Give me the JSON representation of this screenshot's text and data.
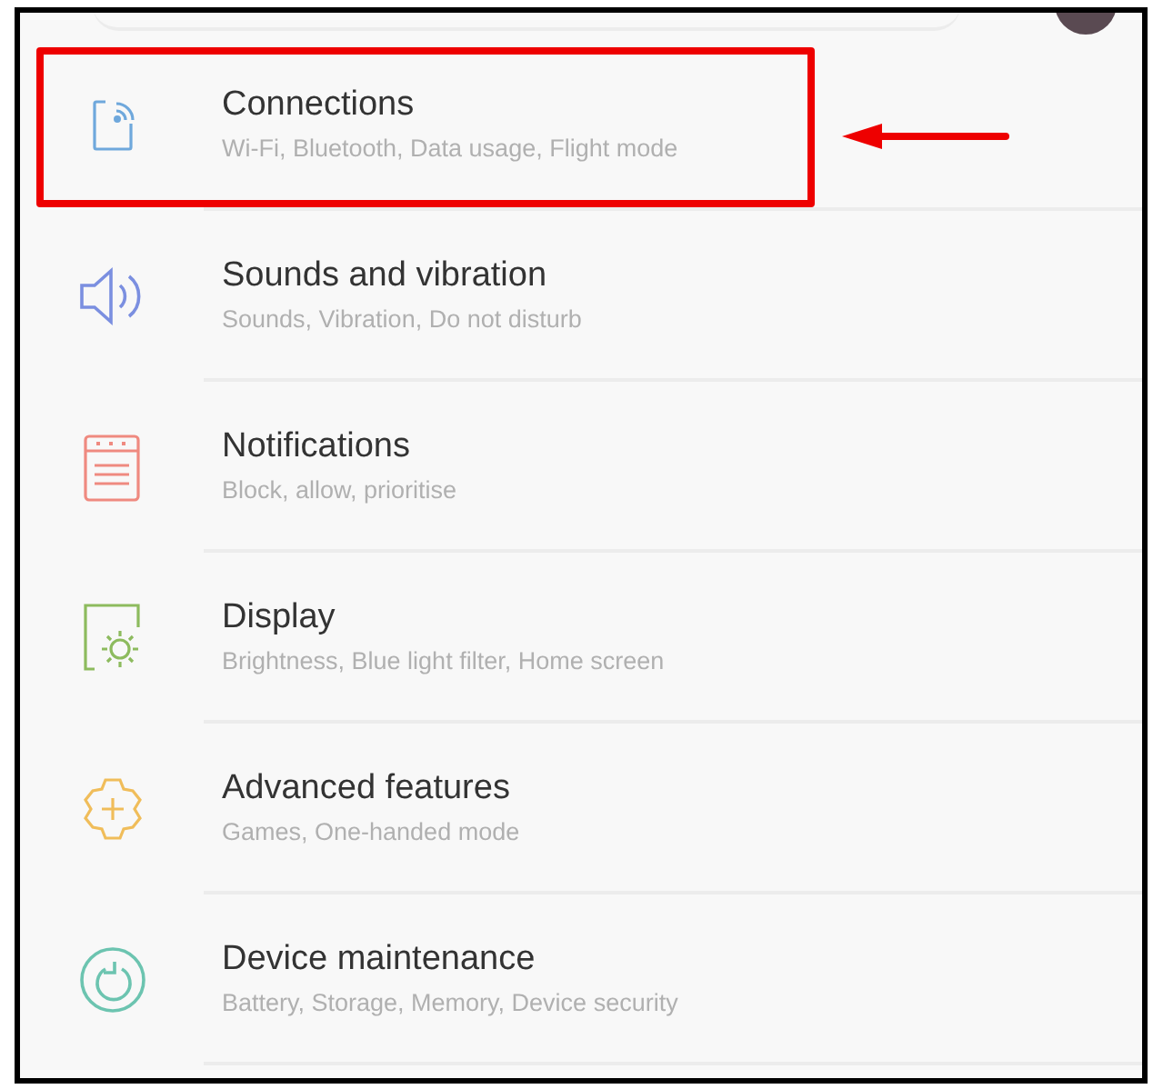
{
  "settings": [
    {
      "title": "Connections",
      "subtitle": "Wi-Fi, Bluetooth, Data usage, Flight mode",
      "kind": "connections",
      "color": "#6fa8dc",
      "highlighted": true
    },
    {
      "title": "Sounds and vibration",
      "subtitle": "Sounds, Vibration, Do not disturb",
      "kind": "sound",
      "color": "#7b8fe0",
      "highlighted": false
    },
    {
      "title": "Notifications",
      "subtitle": "Block, allow, prioritise",
      "kind": "notifications",
      "color": "#ef8a80",
      "highlighted": false
    },
    {
      "title": "Display",
      "subtitle": "Brightness, Blue light filter, Home screen",
      "kind": "display",
      "color": "#8dbb5e",
      "highlighted": false
    },
    {
      "title": "Advanced features",
      "subtitle": "Games, One-handed mode",
      "kind": "advanced",
      "color": "#f0bd5a",
      "highlighted": false
    },
    {
      "title": "Device maintenance",
      "subtitle": "Battery, Storage, Memory, Device security",
      "kind": "maintenance",
      "color": "#6cc4b0",
      "highlighted": false
    }
  ]
}
